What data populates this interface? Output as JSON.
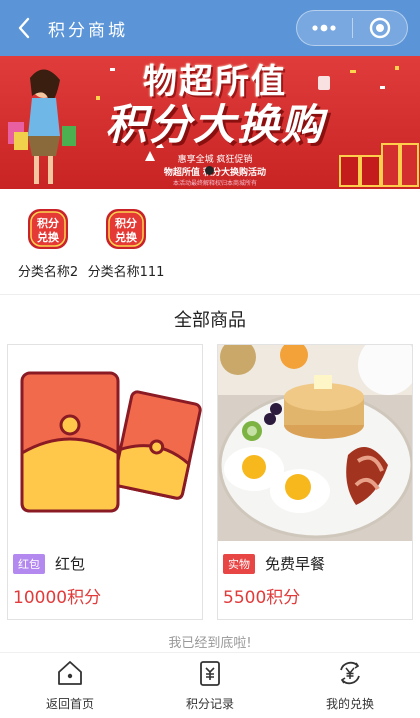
{
  "header": {
    "title": "积分商城",
    "back_icon": "chevron-left-icon",
    "more_icon": "more-dots-icon",
    "close_icon": "target-circle-icon"
  },
  "banner": {
    "line1": "物超所值",
    "line2": "积分大换购",
    "line3": "惠享全城  疯狂促销",
    "line4": "物超所值  积分大换购活动",
    "line5": "本活动最终解释权归本商城所有"
  },
  "categories": [
    {
      "label": "分类名称2",
      "icon": "jifen-duihuan-badge-icon",
      "badge_top": "积分",
      "badge_bottom": "兑换"
    },
    {
      "label": "分类名称111",
      "icon": "jifen-duihuan-badge-icon",
      "badge_top": "积分",
      "badge_bottom": "兑换"
    }
  ],
  "section": {
    "title": "全部商品"
  },
  "products": [
    {
      "tag": "红包",
      "name": "红包",
      "price": "10000积分",
      "image": "red-envelope-image"
    },
    {
      "tag": "实物",
      "name": "免费早餐",
      "price": "5500积分",
      "image": "breakfast-photo"
    }
  ],
  "footer_tip": "我已经到底啦!",
  "tabbar": [
    {
      "label": "返回首页",
      "icon": "home-icon"
    },
    {
      "label": "积分记录",
      "icon": "points-record-icon"
    },
    {
      "label": "我的兑换",
      "icon": "exchange-yen-icon"
    }
  ],
  "colors": {
    "nav": "#5b95d8",
    "accent": "#e23b3b",
    "tag_purple": "#b389f0",
    "tag_red": "#e84545"
  }
}
